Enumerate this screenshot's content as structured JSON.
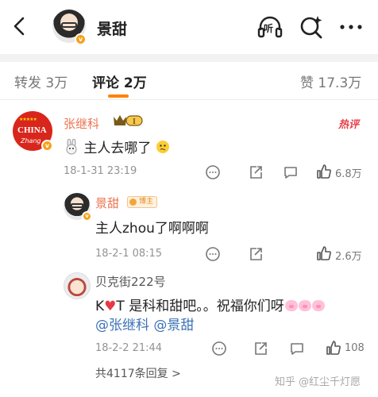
{
  "header": {
    "title": "景甜",
    "listen_label": "听"
  },
  "tabs": [
    {
      "label": "转发 3万"
    },
    {
      "label": "评论 2万"
    },
    {
      "label": "赞 17.3万"
    }
  ],
  "comment": {
    "author": "张继科",
    "level_badge": "I",
    "hot_tag": "热评",
    "avatar_text": {
      "top": "CHINA",
      "bottom": "Zhang"
    },
    "text": "主人去哪了",
    "time": "18-1-31 23:19",
    "likes": "6.8万"
  },
  "replies": [
    {
      "author": "景甜",
      "badge": "博主",
      "text": "主人zhou了啊啊啊",
      "time": "18-2-1 08:15",
      "likes": "2.6万"
    },
    {
      "author": "贝克街222号",
      "text_prefix": "K",
      "text_suffix": "T 是科和甜吧。。祝福你们呀",
      "mention_1": "@张继科",
      "mention_2": "@景甜",
      "time": "18-2-2 21:44",
      "likes": "108"
    }
  ],
  "more_replies": "共4117条回复 >",
  "watermark": "知乎 @红尘千灯愿",
  "colors": {
    "accent": "#ff8200",
    "name": "#eb7350",
    "mention": "#3c72b7",
    "hot": "#e8404a"
  }
}
